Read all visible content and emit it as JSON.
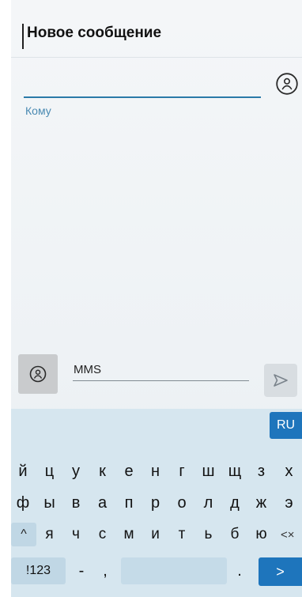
{
  "header": {
    "title": "Новое сообщение"
  },
  "recipient": {
    "label": "Кому",
    "contact_picker_icon": "person-circle-icon"
  },
  "composer": {
    "attach_icon": "person-circle-icon",
    "mms_label": "MMS",
    "send_icon": "send-arrow-icon"
  },
  "keyboard": {
    "language_label": "RU",
    "row1": [
      "й",
      "ц",
      "у",
      "к",
      "е",
      "н",
      "г",
      "ш",
      "щ",
      "з",
      "х"
    ],
    "row2": [
      "ф",
      "ы",
      "в",
      "а",
      "п",
      "р",
      "о",
      "л",
      "д",
      "ж",
      "э"
    ],
    "row3": [
      "я",
      "ч",
      "с",
      "м",
      "и",
      "т",
      "ь",
      "б",
      "ю"
    ],
    "shift_label": "^",
    "backspace_label": "<×",
    "numeric_label": "!123",
    "dash_label": "-",
    "comma_label": ",",
    "period_label": ".",
    "enter_label": ">"
  },
  "colors": {
    "accent": "#1e75bc",
    "underline": "#2a7aa8",
    "keyboard_background": "#d6e6ef"
  }
}
